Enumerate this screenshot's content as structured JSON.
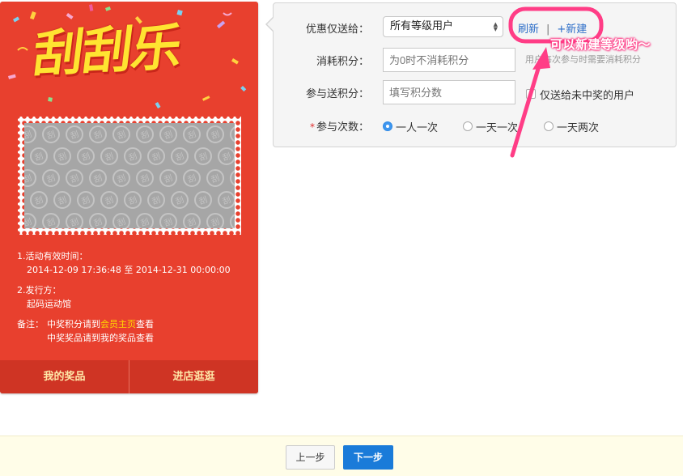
{
  "card": {
    "title": "刮刮乐",
    "scratch_glyph": "刮",
    "info": {
      "time_label": "1.活动有效时间：",
      "time_range": "2014-12-09 17:36:48 至 2014-12-31 00:00:00",
      "issuer_label": "2.发行方：",
      "issuer_name": "起码运动馆",
      "note_label": "备注：",
      "note_line1_prefix": "中奖积分请到",
      "note_line1_link": "会员主页",
      "note_line1_suffix": "查看",
      "note_line2": "中奖奖品请到我的奖品查看"
    },
    "footer": {
      "my_prizes": "我的奖品",
      "visit_store": "进店逛逛"
    }
  },
  "form": {
    "send_to": {
      "label": "优惠仅送给：",
      "selected": "所有等级用户",
      "refresh_link": "刷新",
      "divider": "|",
      "new_link": "+新建"
    },
    "consume_points": {
      "label": "消耗积分：",
      "placeholder": "为0时不消耗积分",
      "hint": "用户每次参与时需要消耗积分"
    },
    "give_points": {
      "label": "参与送积分：",
      "placeholder": "填写积分数",
      "checkbox_label": "仅送给未中奖的用户"
    },
    "participation": {
      "required_mark": "*",
      "label": "参与次数：",
      "options": [
        "一人一次",
        "一天一次",
        "一天两次"
      ],
      "selected_index": 0
    }
  },
  "annotation": {
    "text": "可以新建等级哟～",
    "color": "#ff3d86"
  },
  "bottom_bar": {
    "prev": "上一步",
    "next": "下一步"
  },
  "colors": {
    "card_red": "#e8402e",
    "title_yellow": "#ffe431",
    "link_blue": "#2a6cc7",
    "primary_button": "#1a7bd9"
  }
}
